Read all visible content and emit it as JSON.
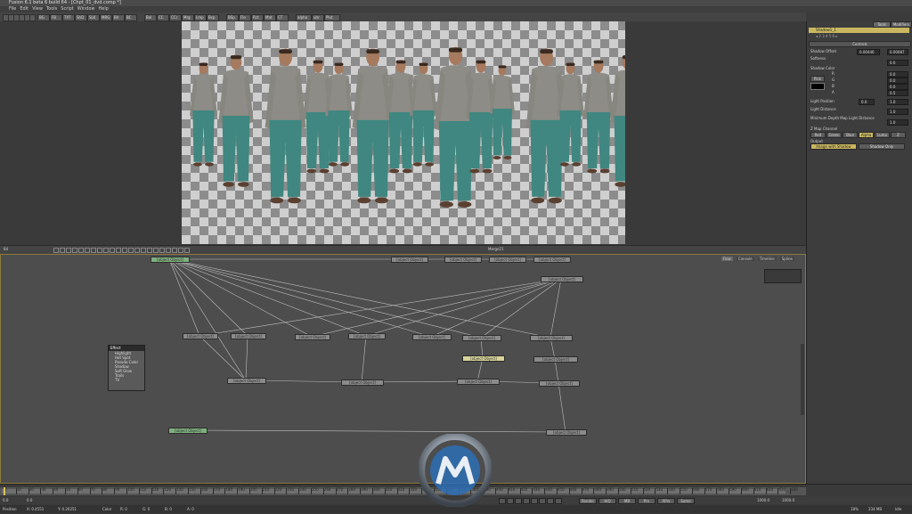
{
  "window": {
    "title": "Fusion 6.1 beta 6 build 64 - [Chpt_01_dvd.comp *]"
  },
  "menu": [
    "File",
    "Edit",
    "View",
    "Tools",
    "Script",
    "Window",
    "Help"
  ],
  "toolbar": {
    "buttons": [
      "BG",
      "FB",
      "TXT",
      "ShD",
      "SLK",
      "MRG",
      "Blr",
      "BC",
      "Bol",
      "CC",
      "CCr",
      "Mrg",
      "Lmp",
      "Bsp",
      "BSp",
      "Fle",
      "Rct",
      "Mat",
      "CT",
      "alpha",
      "uhr",
      "Plut"
    ]
  },
  "viewer": {
    "label": "Merge21",
    "zoom": "84"
  },
  "flow": {
    "tabs": [
      "Flow",
      "Console",
      "Timeline",
      "Spline"
    ],
    "nodes": [
      {
        "id": "background9",
        "label": "Background9 (BG)"
      },
      {
        "id": "m1",
        "label": "Merge1 (Mrg)"
      },
      {
        "id": "m2",
        "label": "Merge2 (Mrg)"
      },
      {
        "id": "m3",
        "label": "Merge3 (Mrg)"
      },
      {
        "id": "m4",
        "label": "Merge4 (Mrg)"
      },
      {
        "id": "m5",
        "label": "Merge5 (Mrg)"
      },
      {
        "id": "m6",
        "label": "Merge6 (Mrg)"
      },
      {
        "id": "m7",
        "label": "Merge7 (Mrg)"
      },
      {
        "id": "m8",
        "label": "Merge8 (Mrg)"
      },
      {
        "id": "m9",
        "label": "Merge9 (Mrg)"
      },
      {
        "id": "m10",
        "label": "Merge10 (Mrg)"
      },
      {
        "id": "m11",
        "label": "Merge11 (Mrg)"
      },
      {
        "id": "m12",
        "label": "Merge12 (Mrg)"
      },
      {
        "id": "m13",
        "label": "Merge13 (Mrg)"
      },
      {
        "id": "m14",
        "label": "Merge14 (Mrg)"
      },
      {
        "id": "m15",
        "label": "Merge15 (Mrg)"
      },
      {
        "id": "m16",
        "label": "Merge16 (Mrg)"
      },
      {
        "id": "m17",
        "label": "Merge17 (Mrg)"
      },
      {
        "id": "shadow",
        "label": "Shadow1_1 (Sh)"
      },
      {
        "id": "bg2",
        "label": "Background2 (BG)"
      },
      {
        "id": "m21",
        "label": "Merge21 (Mrg)"
      },
      {
        "id": "pathloader",
        "label": "PathLoader1 (Ld)"
      }
    ]
  },
  "context_menu": {
    "title": "Effect",
    "items": [
      "Highlight",
      "Hot Spot",
      "Pseudo Color",
      "Shadow",
      "Soft Glow",
      "Trails",
      "TV"
    ]
  },
  "inspector": {
    "tabs": [
      "Tools",
      "Modifiers"
    ],
    "node_title": "Shadow1_1",
    "section": "Controls",
    "shadow_offset_label": "Shadow Offset",
    "shadow_offset_x": "0.00446",
    "shadow_offset_y": "0.00087",
    "softness_label": "Softness",
    "softness_value": "0.0",
    "shadow_color_label": "Shadow Color",
    "pick_label": "Pick",
    "r_label": "R",
    "g_label": "G",
    "b_label": "B",
    "a_label": "A",
    "r_value": "0.0",
    "g_value": "0.0",
    "b_value": "0.0",
    "a_value": "0.5",
    "light_position_label": "Light Position",
    "light_position_x": "0.0",
    "light_position_y": "1.0",
    "light_distance_label": "Light Distance",
    "light_distance_value": "1.0",
    "min_depth_label": "Minimum Depth Map Light Distance",
    "min_depth_value": "1.0",
    "zmap_label": "Z Map Channel",
    "zmap_options": [
      "Red",
      "Green",
      "Blue",
      "Alpha",
      "Luma",
      "Z"
    ],
    "zmap_selected": "Alpha",
    "output_label": "Output",
    "output_options": [
      "Image with Shadow",
      "Shadow Only"
    ]
  },
  "timeline": {
    "start": "0.0",
    "end": "1000.0",
    "current": "0.0",
    "ruler_labels": [
      "0",
      "10",
      "20",
      "30",
      "40",
      "50",
      "60",
      "70",
      "80",
      "90",
      "100",
      "110",
      "120",
      "130",
      "140",
      "150",
      "160",
      "170",
      "180",
      "190",
      "200",
      "210",
      "220",
      "230",
      "240",
      "250",
      "260",
      "270",
      "280",
      "290",
      "300",
      "310",
      "320",
      "330",
      "340",
      "350",
      "360",
      "370",
      "380",
      "390",
      "400",
      "410",
      "420",
      "430",
      "440",
      "450",
      "460",
      "470",
      "480",
      "490",
      "500",
      "510",
      "520",
      "530",
      "540",
      "550",
      "560",
      "570",
      "580",
      "590",
      "600",
      "610",
      "620",
      "630",
      "640"
    ],
    "buttons": [
      "Render",
      "HiQ",
      "MB",
      "Prx",
      "APrx",
      "Some"
    ],
    "render_end": "1000.0",
    "render_end2": "1000.0"
  },
  "status": {
    "position": "Position",
    "x": "X: 0.4551",
    "y": "Y: 0.20251",
    "color": "Color",
    "r": "R: 0",
    "g": "G: 0",
    "b": "B: 0",
    "a": "A: 0",
    "zoom": "18%",
    "memory": "234 MB",
    "state": "Idle"
  }
}
